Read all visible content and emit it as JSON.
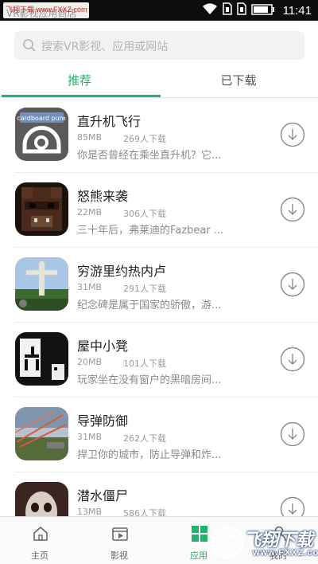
{
  "status_bar": {
    "watermark_text": "飞翔下载 www.FXXZ.com",
    "app_name": "VR影视应用商店",
    "time": "11:41",
    "icons": [
      "wifi-icon",
      "sim-icon",
      "sim-icon",
      "battery-icon"
    ]
  },
  "search": {
    "placeholder": "搜索VR影视、应用或网站",
    "icon": "search-icon"
  },
  "tabs": [
    {
      "label": "推荐",
      "active": true
    },
    {
      "label": "已下载",
      "active": false
    }
  ],
  "colors": {
    "accent": "#23b26d",
    "text_primary": "#222222",
    "text_secondary": "#9a9a9a"
  },
  "apps": [
    {
      "title": "直升机飞行",
      "size": "85MB",
      "downloads": "269人下载",
      "desc": "你是否曾经在乘坐直升机？它...",
      "thumb_text": "cardboard pure"
    },
    {
      "title": "怒熊来袭",
      "size": "22MB",
      "downloads": "306人下载",
      "desc": "三十年后，弗莱迪的Fazbear ..."
    },
    {
      "title": "穷游里约热内卢",
      "size": "31MB",
      "downloads": "291人下载",
      "desc": "纪念碑是属于国家的骄傲，游..."
    },
    {
      "title": "屋中小凳",
      "size": "20MB",
      "downloads": "101人下载",
      "desc": "玩家坐在没有窗户的黑暗房间..."
    },
    {
      "title": "导弹防御",
      "size": "31MB",
      "downloads": "262人下载",
      "desc": "捍卫你的城市，防止导弹和炸..."
    },
    {
      "title": "潜水僵尸",
      "size": "13MB",
      "downloads": "586人下载",
      "desc": ""
    }
  ],
  "bottom_nav": [
    {
      "label": "主页",
      "icon": "home-icon",
      "active": false
    },
    {
      "label": "影视",
      "icon": "video-icon",
      "active": false
    },
    {
      "label": "应用",
      "icon": "apps-icon",
      "active": true
    },
    {
      "label": "我的",
      "icon": "profile-icon",
      "active": false
    }
  ],
  "overlay_watermark": {
    "title": "飞翔下载",
    "url": "www.FXXZ.com"
  }
}
